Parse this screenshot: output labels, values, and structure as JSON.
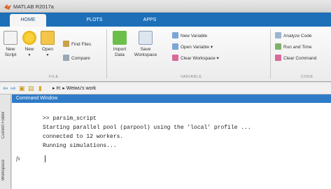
{
  "window": {
    "title": "MATLAB R2017a"
  },
  "tabs": [
    {
      "label": "HOME",
      "active": true
    },
    {
      "label": "PLOTS",
      "active": false
    },
    {
      "label": "APPS",
      "active": false
    }
  ],
  "ribbon": {
    "file": {
      "new_script": "New\nScript",
      "new": "New",
      "open": "Open",
      "find_files": "Find Files",
      "compare": "Compare",
      "label": "FILE"
    },
    "variable": {
      "import_data": "Import\nData",
      "save_workspace": "Save\nWorkspace",
      "new_variable": "New Variable",
      "open_variable": "Open Variable",
      "clear_workspace": "Clear Workspace",
      "label": "VARIABLE"
    },
    "code": {
      "analyze_code": "Analyze Code",
      "run_and_time": "Run and Time",
      "clear_commands": "Clear Command",
      "label": "CODE"
    }
  },
  "address": {
    "path": "▸ H: ▸ Weiwu's work"
  },
  "side_tabs": {
    "current_folder": "Current Folder",
    "workspace": "Workspace"
  },
  "command_window": {
    "title": "Command Window",
    "lines": [
      ">> parsim_script",
      "Starting parallel pool (parpool) using the 'local' profile ...",
      "connected to 12 workers.",
      "Running simulations..."
    ],
    "prompt_symbol": "fx"
  },
  "colors": {
    "accent": "#1d6fb8",
    "panel_header": "#2f7bc8"
  }
}
